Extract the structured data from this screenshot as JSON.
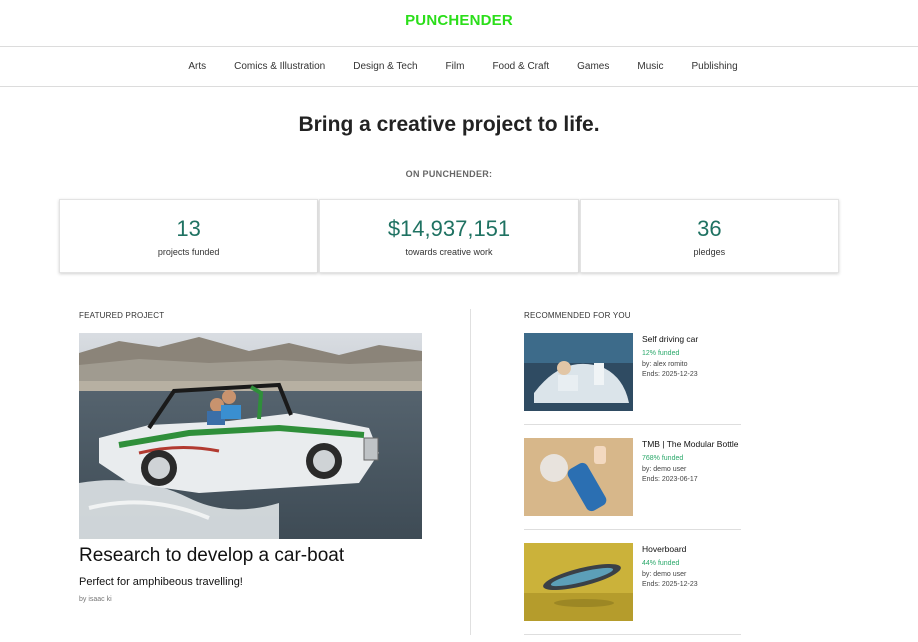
{
  "brand": {
    "logo": "PUNCHENDER",
    "color": "#2bde1a"
  },
  "nav": {
    "categories": [
      "Arts",
      "Comics & Illustration",
      "Design & Tech",
      "Film",
      "Food & Craft",
      "Games",
      "Music",
      "Publishing"
    ]
  },
  "hero": {
    "headline": "Bring a creative project to life.",
    "stats_label": "ON PUNCHENDER:"
  },
  "stats": [
    {
      "value": "13",
      "label": "projects funded"
    },
    {
      "value": "$14,937,151",
      "label": "towards creative work"
    },
    {
      "value": "36",
      "label": "pledges"
    }
  ],
  "accent_color": "#1f7262",
  "featured": {
    "section_label": "FEATURED PROJECT",
    "title": "Research to develop a car-boat",
    "blurb": "Perfect for amphibeous travelling!",
    "author": "by isaac ki",
    "image_alt": "amphibious car-boat on water"
  },
  "recommended": {
    "section_label": "RECOMMENDED FOR YOU",
    "items": [
      {
        "title": "Self driving car",
        "funded": "12% funded",
        "by": "by: alex romito",
        "ends": "Ends: 2025-12-23"
      },
      {
        "title": "TMB | The Modular Bottle",
        "funded": "768% funded",
        "by": "by: demo user",
        "ends": "Ends: 2023-06-17"
      },
      {
        "title": "Hoverboard",
        "funded": "44% funded",
        "by": "by: demo user",
        "ends": "Ends: 2025-12-23"
      }
    ]
  }
}
